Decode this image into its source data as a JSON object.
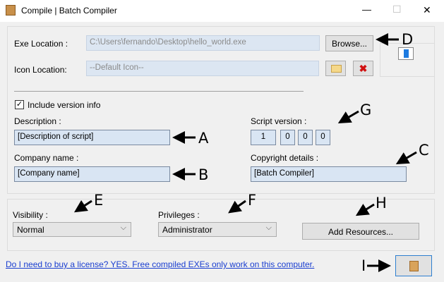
{
  "window": {
    "title": "Compile | Batch Compiler",
    "minimize": "—",
    "maximize": "☐",
    "close": "✕"
  },
  "exe": {
    "label": "Exe Location :",
    "value": "C:\\Users\\fernando\\Desktop\\hello_world.exe",
    "browse": "Browse..."
  },
  "icon": {
    "label": "Icon Location:",
    "value": "--Default Icon--"
  },
  "version": {
    "checkbox_label": "Include version info",
    "checked": true,
    "description_label": "Description :",
    "description_value": "[Description of script]",
    "company_label": "Company name :",
    "company_value": "[Company name]",
    "script_version_label": "Script version :",
    "script_version": [
      "1",
      "0",
      "0",
      "0"
    ],
    "copyright_label": "Copyright details :",
    "copyright_value": "[Batch Compiler]"
  },
  "options": {
    "visibility_label": "Visibility :",
    "visibility_value": "Normal",
    "privileges_label": "Privileges :",
    "privileges_value": "Administrator",
    "add_resources": "Add Resources..."
  },
  "footer": {
    "license_link": "Do I need to buy a license? YES. Free compiled EXEs only work on this computer."
  },
  "annotations": {
    "A": "A",
    "B": "B",
    "C": "C",
    "D": "D",
    "E": "E",
    "F": "F",
    "G": "G",
    "H": "H",
    "I": "I"
  }
}
